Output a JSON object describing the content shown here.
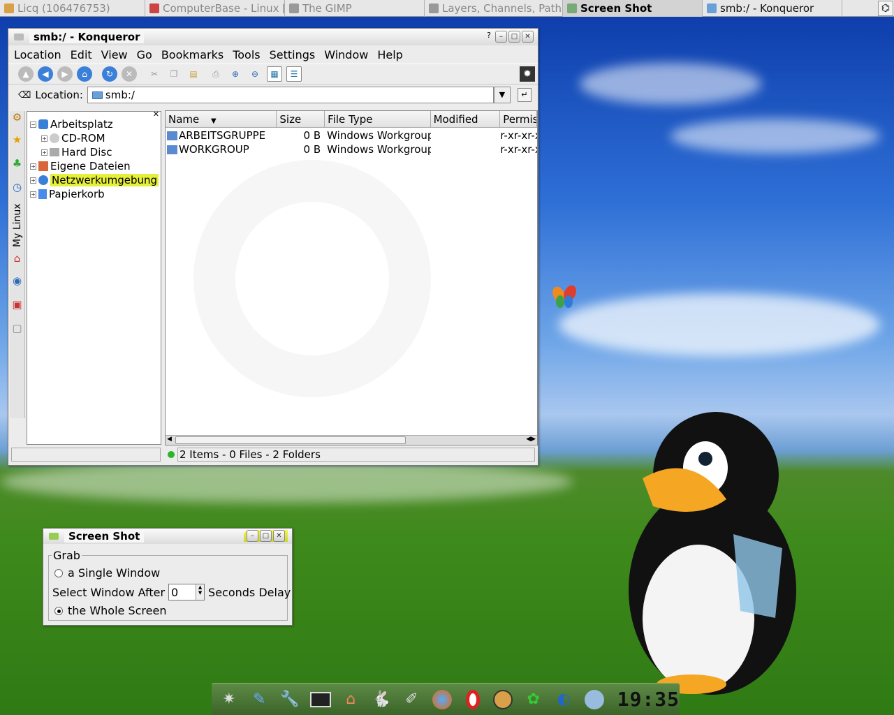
{
  "taskbar": {
    "tasks": [
      {
        "label": "Licq (106476753)",
        "state": "inactive"
      },
      {
        "label": "ComputerBase - Linux [",
        "state": "inactive"
      },
      {
        "label": "The GIMP",
        "state": "inactive"
      },
      {
        "label": "Layers, Channels, Paths",
        "state": "inactive"
      },
      {
        "label": "Screen Shot",
        "state": "active"
      },
      {
        "label": "smb:/ - Konqueror",
        "state": "normal"
      }
    ]
  },
  "konqueror": {
    "title": "smb:/ - Konqueror",
    "menu": [
      "Location",
      "Edit",
      "View",
      "Go",
      "Bookmarks",
      "Tools",
      "Settings",
      "Window",
      "Help"
    ],
    "location_label": "Location:",
    "location_value": "smb:/",
    "tree": [
      {
        "label": "Arbeitsplatz",
        "highlight": false
      },
      {
        "label": "CD-ROM",
        "highlight": false
      },
      {
        "label": "Hard Disc",
        "highlight": false
      },
      {
        "label": "Eigene Dateien",
        "highlight": false
      },
      {
        "label": "Netzwerkumgebung",
        "highlight": true
      },
      {
        "label": "Papierkorb",
        "highlight": false
      }
    ],
    "side_tab_label": "My Linux",
    "columns": [
      "Name",
      "Size",
      "File Type",
      "Modified",
      "Permis"
    ],
    "rows": [
      {
        "name": "ARBEITSGRUPPE",
        "size": "0 B",
        "type": "Windows Workgroup",
        "modified": "",
        "perms": "r-xr-xr-x"
      },
      {
        "name": "WORKGROUP",
        "size": "0 B",
        "type": "Windows Workgroup",
        "modified": "",
        "perms": "r-xr-xr-x"
      }
    ],
    "status": "2 Items - 0 Files - 2 Folders"
  },
  "screenshot": {
    "title": "Screen Shot",
    "group_label": "Grab",
    "opt_single": "a Single Window",
    "delay_prefix": "Select Window After",
    "delay_value": "0",
    "delay_suffix": "Seconds Delay",
    "opt_whole": "the Whole Screen"
  },
  "dock": {
    "clock": "19:35"
  },
  "colors": {
    "highlight": "#e6f03a",
    "accent": "#5e8a47"
  }
}
